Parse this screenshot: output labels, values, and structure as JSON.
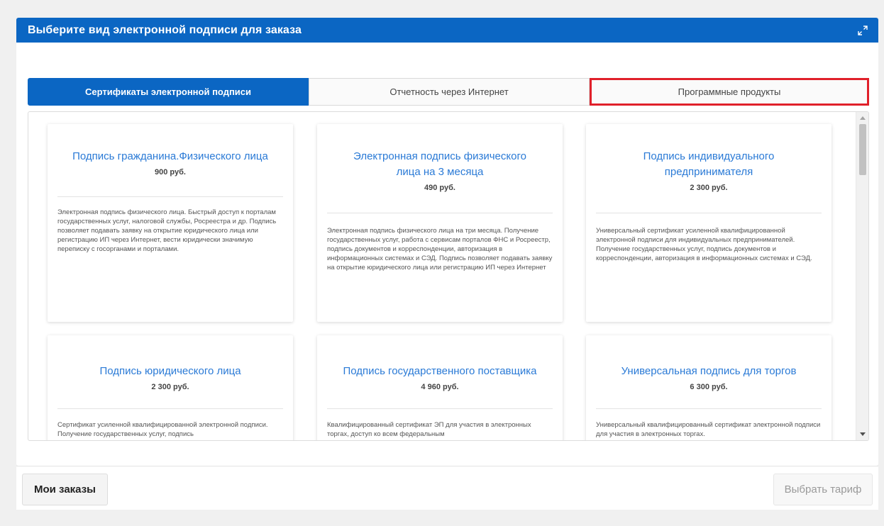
{
  "dialog": {
    "title": "Выберите вид электронной подписи для заказа",
    "expand_icon": "expand-icon"
  },
  "tabs": [
    {
      "label": "Сертификаты электронной подписи",
      "active": true
    },
    {
      "label": "Отчетность через Интернет",
      "active": false
    },
    {
      "label": "Программные продукты",
      "active": false
    }
  ],
  "cards": [
    {
      "title": "Подпись гражданина.Физического лица",
      "price": "900 руб.",
      "description": "Электронная подпись физического лица. Быстрый доступ к порталам государственных услуг, налоговой службы, Росреестра и др. Подпись позволяет подавать заявку на открытие юридического лица или регистрацию ИП через Интернет, вести юридически значимую переписку с госорганами и порталами."
    },
    {
      "title": "Электронная подпись физического лица на 3 месяца",
      "price": "490 руб.",
      "description": "Электронная подпись физического лица на три месяца. Получение государственных услуг, работа с сервисам порталов ФНС и Росреестр, подпись документов и корреспонденции, авторизация в информационных системах и СЭД. Подпись позволяет подавать заявку на открытие юридического лица или регистрацию ИП через Интернет"
    },
    {
      "title": "Подпись индивидуального предпринимателя",
      "price": "2 300 руб.",
      "description": "Универсальный сертификат усиленной квалифицированной электронной подписи для индивидуальных предпринимателей. Получение государственных услуг, подпись документов и корреспонденции, авторизация в информационных системах и СЭД."
    },
    {
      "title": "Подпись юридического лица",
      "price": "2 300 руб.",
      "description": "Сертификат усиленной квалифицированной электронной подписи. Получение государственных услуг, подпись"
    },
    {
      "title": "Подпись государственного поставщика",
      "price": "4 960 руб.",
      "description": "Квалифицированный сертификат ЭП для участия в электронных торгах, доступ ко всем федеральным"
    },
    {
      "title": "Универсальная подпись для торгов",
      "price": "6 300 руб.",
      "description": "Универсальный квалифицированный сертификат электронной подписи для участия в электронных торгах."
    }
  ],
  "footer": {
    "orders_button": "Мои заказы",
    "choose_button": "Выбрать тариф"
  },
  "colors": {
    "accent": "#0b66c3",
    "link": "#2a7ad6",
    "highlight": "#e0202a"
  }
}
